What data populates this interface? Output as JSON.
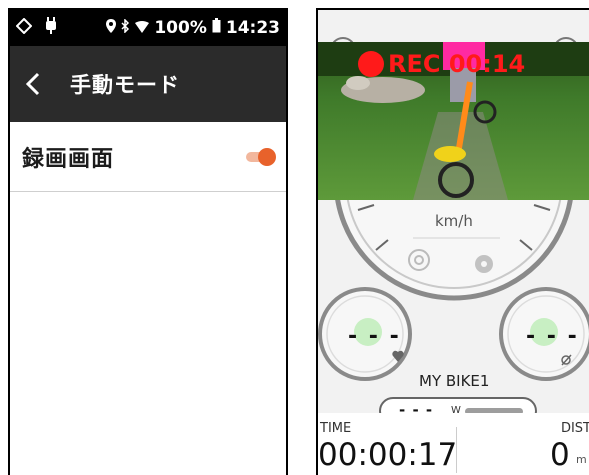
{
  "left_screen": {
    "status_bar": {
      "battery": "100%",
      "time": "14:23"
    },
    "app_bar": {
      "back_icon": "chevron-left-icon",
      "title": "手動モード"
    },
    "settings": [
      {
        "label": "録画画面",
        "toggle_on": true,
        "accent_color": "#e8622b"
      }
    ]
  },
  "right_screen": {
    "recording": {
      "label": "REC 00:14",
      "color": "#ff1a1a"
    },
    "speed_unit": "km/h",
    "heart_rate_value": "- - -",
    "cadence_value": "- - -",
    "bike_name": "MY BIKE1",
    "power": {
      "value": "- - -",
      "unit": "W"
    },
    "time": {
      "label": "TIME",
      "value": "00:00:17"
    },
    "distance": {
      "label": "DIST",
      "value": "0",
      "unit": "m"
    }
  }
}
